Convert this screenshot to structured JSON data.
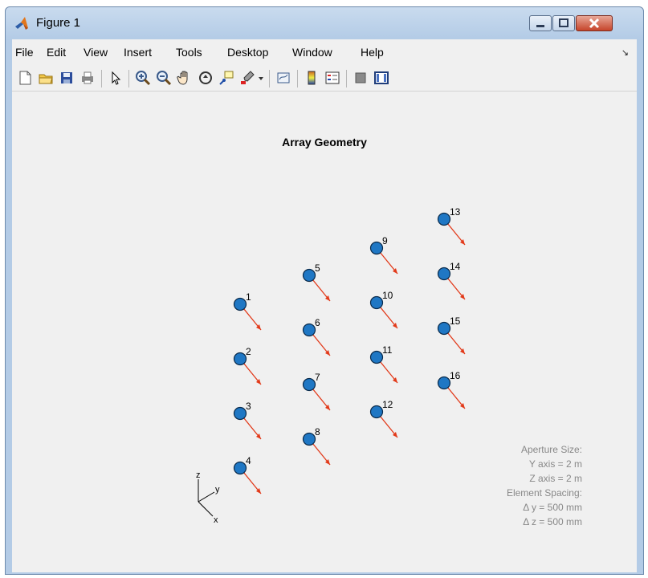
{
  "window": {
    "title": "Figure 1",
    "icon": "matlab-logo-icon",
    "controls": [
      "minimize-icon",
      "maximize-icon",
      "close-icon"
    ]
  },
  "menubar": {
    "items": [
      "File",
      "Edit",
      "View",
      "Insert",
      "Tools",
      "Desktop",
      "Window",
      "Help"
    ]
  },
  "toolbar": {
    "buttons": [
      "new-figure-icon",
      "open-file-icon",
      "save-icon",
      "print-icon",
      "edit-plot-arrow-icon",
      "zoom-in-icon",
      "zoom-out-icon",
      "pan-hand-icon",
      "rotate-3d-icon",
      "data-cursor-icon",
      "brush-icon",
      "link-plot-icon",
      "colorbar-icon",
      "legend-icon",
      "hide-plot-tools-icon",
      "show-plot-tools-icon"
    ]
  },
  "plot": {
    "title": "Array Geometry",
    "elements": [
      {
        "id": "1"
      },
      {
        "id": "2"
      },
      {
        "id": "3"
      },
      {
        "id": "4"
      },
      {
        "id": "5"
      },
      {
        "id": "6"
      },
      {
        "id": "7"
      },
      {
        "id": "8"
      },
      {
        "id": "9"
      },
      {
        "id": "10"
      },
      {
        "id": "11"
      },
      {
        "id": "12"
      },
      {
        "id": "13"
      },
      {
        "id": "14"
      },
      {
        "id": "15"
      },
      {
        "id": "16"
      }
    ],
    "axes_triad": {
      "x": "x",
      "y": "y",
      "z": "z"
    },
    "info": {
      "aperture_title": "Aperture Size:",
      "y_axis": "Y axis = 2 m",
      "z_axis": "Z axis = 2 m",
      "spacing_title": "Element Spacing:",
      "delta_y": "Δ y = 500 mm",
      "delta_z": "Δ z = 500 mm"
    },
    "colors": {
      "element_fill": "#1f77c4",
      "element_stroke": "#0a2a4a",
      "normal_arrow": "#e23a1a",
      "info_text": "#888888"
    }
  }
}
